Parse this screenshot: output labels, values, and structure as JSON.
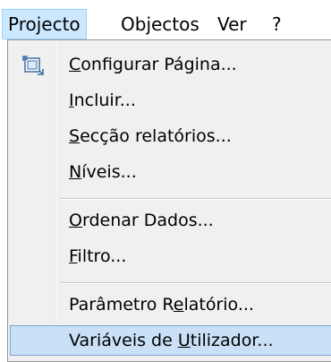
{
  "menubar": {
    "items": [
      {
        "label": "Projecto",
        "active": true
      },
      {
        "label": "Objectos",
        "active": false
      },
      {
        "label": "Ver",
        "active": false
      },
      {
        "label": "?",
        "active": false
      }
    ]
  },
  "dropdown": {
    "items": [
      {
        "pre": "",
        "u": "C",
        "post": "onfigurar Página...",
        "icon": "page-setup-icon"
      },
      {
        "pre": "",
        "u": "I",
        "post": "ncluir..."
      },
      {
        "pre": "",
        "u": "S",
        "post": "ecção relatórios..."
      },
      {
        "pre": "",
        "u": "N",
        "post": "íveis..."
      },
      {
        "pre": "",
        "u": "O",
        "post": "rdenar Dados..."
      },
      {
        "pre": "",
        "u": "F",
        "post": "iltro..."
      },
      {
        "pre": "Parâmetro R",
        "u": "e",
        "post": "latório..."
      },
      {
        "pre": "Variáveis de ",
        "u": "U",
        "post": "tilizador...",
        "highlighted": true
      }
    ]
  },
  "colors": {
    "menubar_active_bg": "#cce8ff",
    "menubar_active_border": "#99d1ff",
    "dropdown_bg": "#f0f0f0",
    "highlight_bg": "#c9e0f7",
    "highlight_border": "#7aa7d6"
  }
}
